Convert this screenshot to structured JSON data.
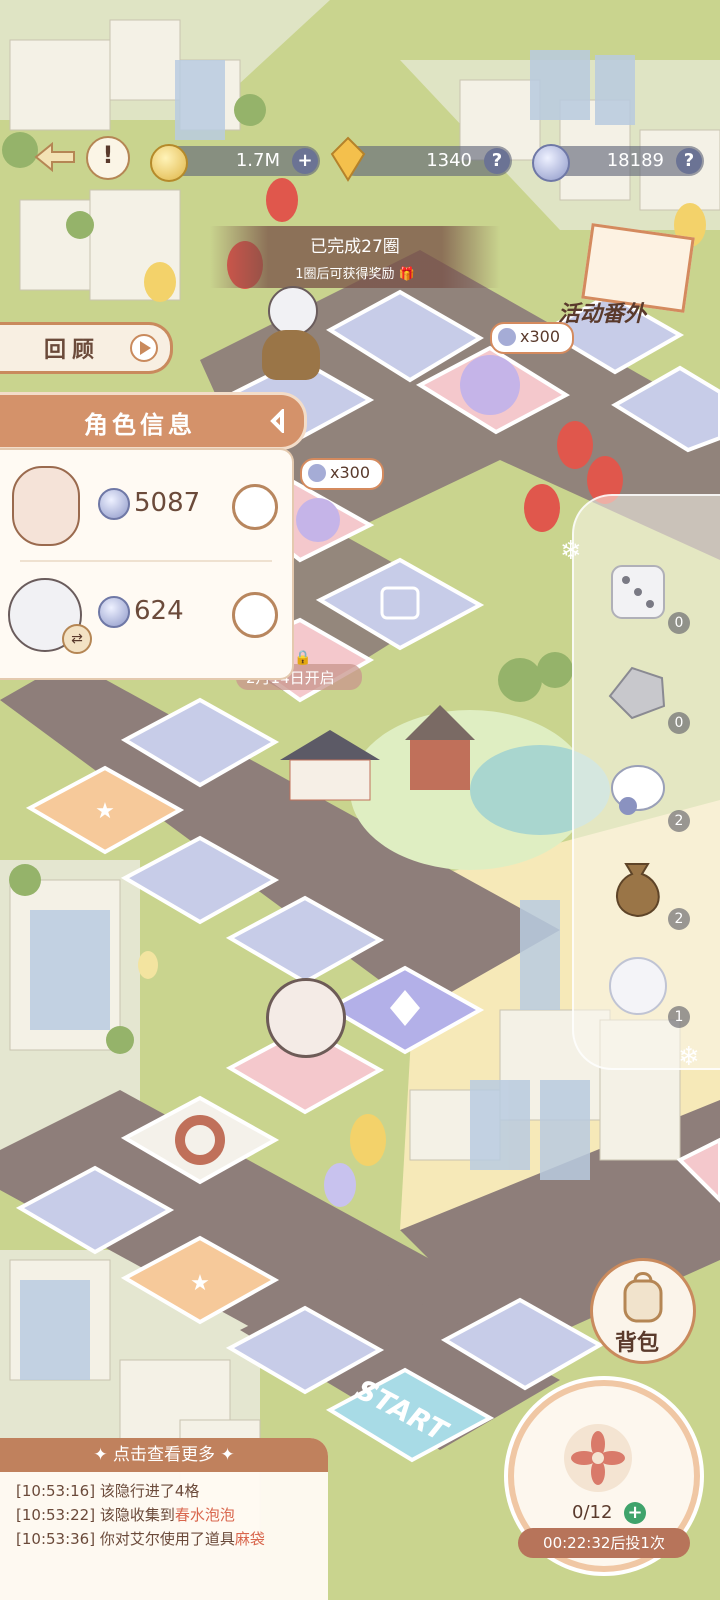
{
  "top_bar": {
    "gold": "1.7M",
    "crystal": "1340",
    "token": "18189",
    "plus_glyph": "+",
    "help_glyph": "?"
  },
  "progress": {
    "completed": "已完成27圈",
    "next_reward": "1圈后可获得奖励"
  },
  "review_label": "回顾",
  "event_label": "活动番外",
  "board": {
    "reward_1": "x300",
    "reward_2": "x300",
    "locked_tile_text": "2月14日开启",
    "start_tile": "START"
  },
  "character_panel": {
    "title": "角色信息",
    "characters": [
      {
        "value": "5087"
      },
      {
        "value": "624"
      }
    ]
  },
  "items": [
    {
      "name": "dice",
      "count": "0"
    },
    {
      "name": "rock",
      "count": "0"
    },
    {
      "name": "glove",
      "count": "2"
    },
    {
      "name": "sack",
      "count": "2"
    },
    {
      "name": "snowball",
      "count": "1"
    }
  ],
  "bag_label": "背包",
  "dice_button": {
    "count": "0/12",
    "timer": "00:22:32后投1次"
  },
  "log": {
    "header": "点击查看更多",
    "entries": [
      {
        "time": "[10:53:16]",
        "text": "该隐行进了4格",
        "highlight": ""
      },
      {
        "time": "[10:53:22]",
        "text": "该隐收集到",
        "highlight": "春水泡泡"
      },
      {
        "time": "[10:53:36]",
        "text": "你对艾尔使用了道具",
        "highlight": "麻袋"
      }
    ]
  },
  "colors": {
    "accent": "#c98a5d",
    "grass": "#c9d48e",
    "road": "#8e7e7a",
    "tile_blue": "#c7cce8",
    "tile_pink": "#f4c8cc",
    "tile_orange": "#f6c99a",
    "tile_purple": "#b3b0e8"
  }
}
